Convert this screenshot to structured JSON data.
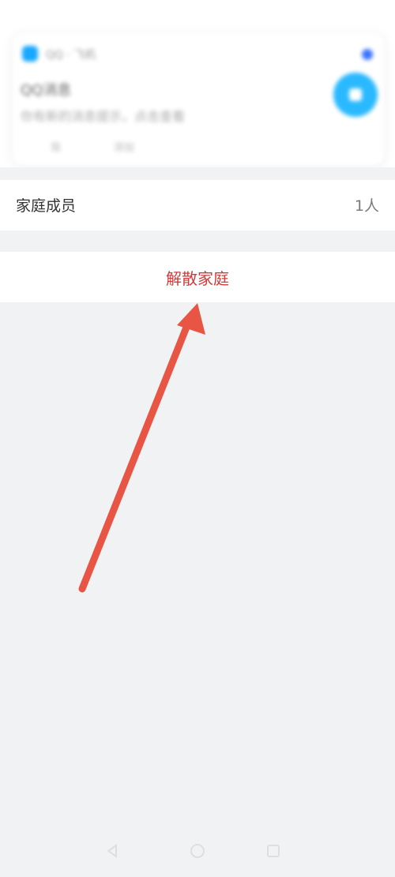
{
  "notification": {
    "app_name": "QQ · 飞机",
    "title": "QQ消息",
    "body": "你有新的消息提示，点击查看",
    "action_left": "我",
    "action_right": "添加"
  },
  "family_members": {
    "label": "家庭成员",
    "count": "1人"
  },
  "dissolve": {
    "label": "解散家庭"
  },
  "colors": {
    "page_bg": "#f0f2f4",
    "danger": "#d23a3a",
    "annotation_arrow": "#e85545"
  }
}
